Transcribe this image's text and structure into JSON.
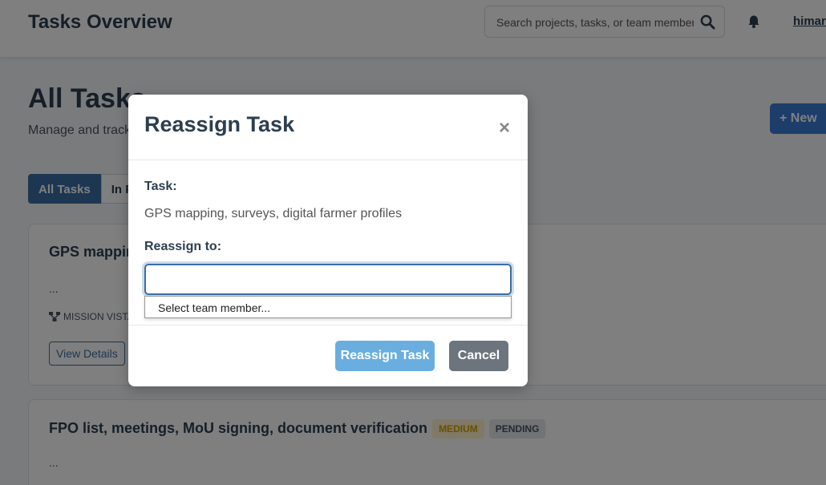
{
  "header": {
    "title": "Tasks Overview",
    "search_placeholder": "Search projects, tasks, or team members",
    "username": "himanshu"
  },
  "page": {
    "heading": "All Tasks",
    "subtitle": "Manage and track",
    "new_button": "+ New"
  },
  "tabs": [
    {
      "label": "All Tasks",
      "active": true
    },
    {
      "label": "In P",
      "active": false
    }
  ],
  "tasks": [
    {
      "title": "GPS mapping",
      "description": "...",
      "project": "MISSION VISTA",
      "view_label": "View Details"
    },
    {
      "title": "FPO list, meetings, MoU signing, document verification",
      "priority": "MEDIUM",
      "status": "PENDING",
      "description": "..."
    }
  ],
  "modal": {
    "title": "Reassign Task",
    "close_symbol": "×",
    "task_label": "Task:",
    "task_name": "GPS mapping, surveys, digital farmer profiles",
    "reassign_label": "Reassign to:",
    "input_value": "",
    "dropdown_option": "Select team member...",
    "submit_label": "Reassign Task",
    "cancel_label": "Cancel"
  },
  "colors": {
    "primary": "#3a6ea5",
    "submit": "#6aaee0",
    "cancel": "#6c757d",
    "overlay": "rgba(0,0,0,0.5)"
  }
}
